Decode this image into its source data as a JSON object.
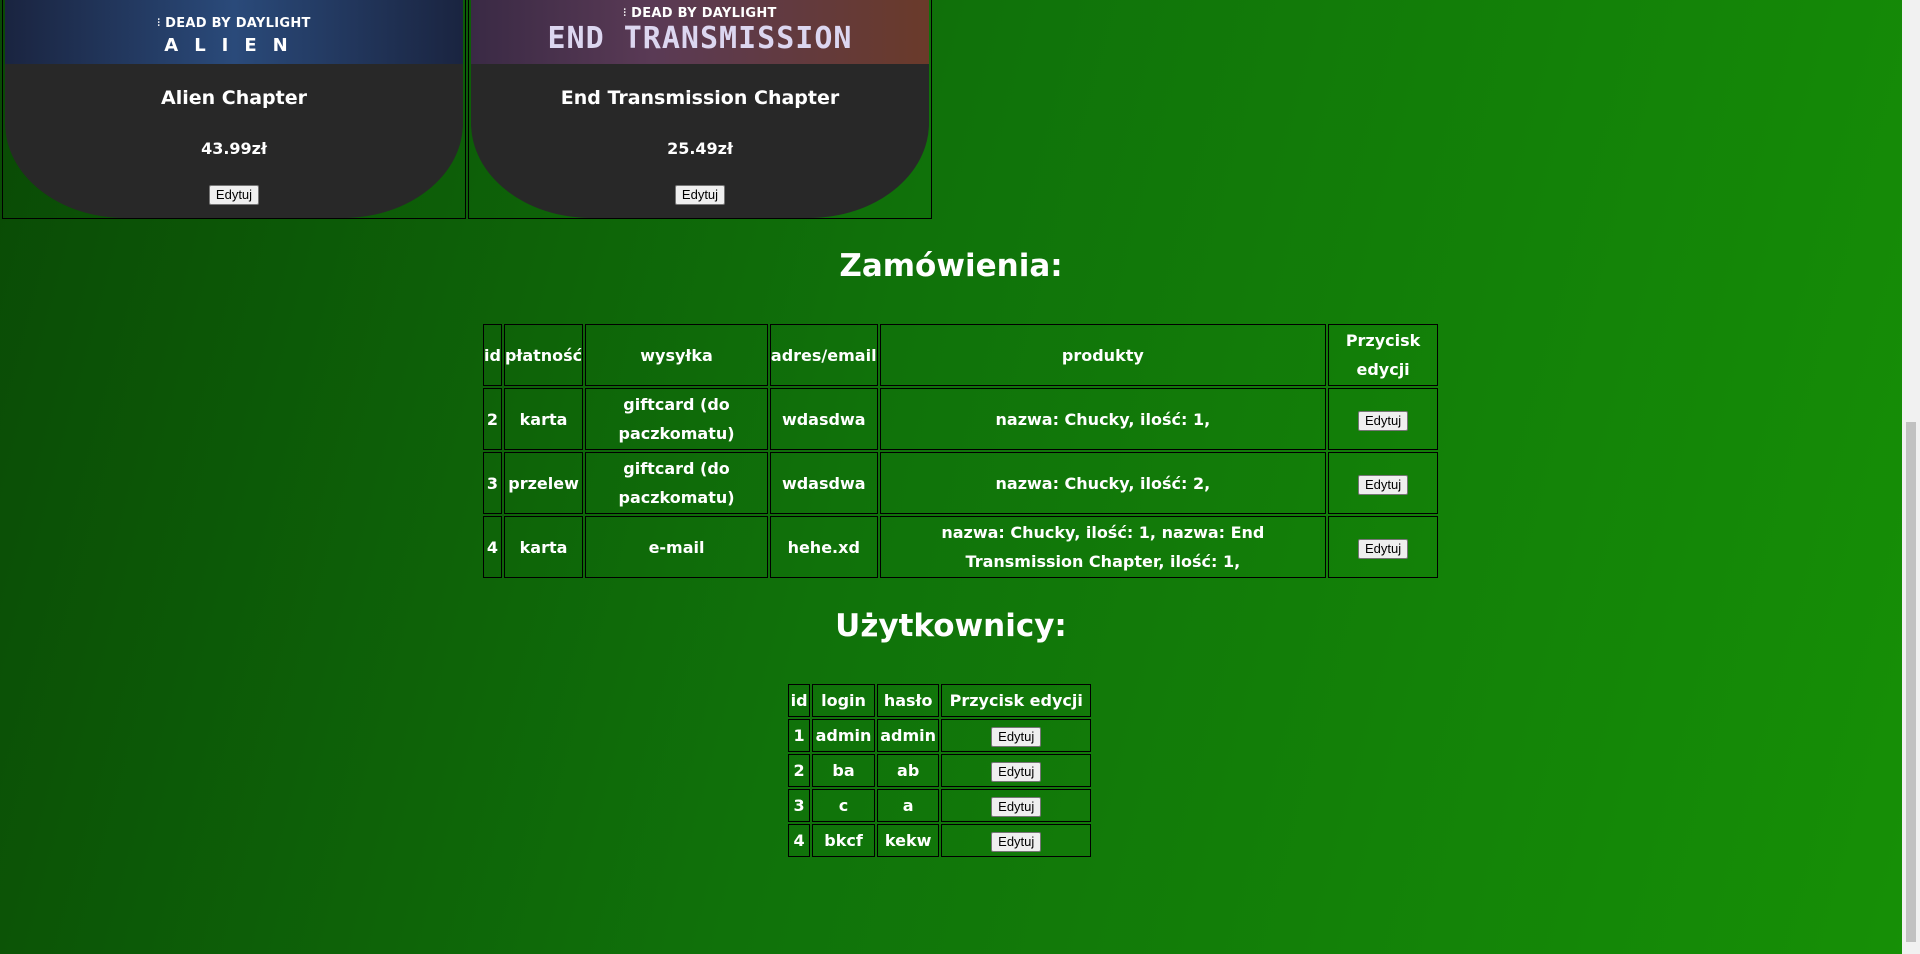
{
  "products": [
    {
      "banner_brand": "DEAD BY DAYLIGHT",
      "banner_game": "ALIEN",
      "title": "Alien Chapter",
      "price": "43.99zł",
      "button": "Edytuj"
    },
    {
      "banner_brand": "DEAD BY DAYLIGHT",
      "banner_game": "END TRANSMISSION",
      "title": "End Transmission Chapter",
      "price": "25.49zł",
      "button": "Edytuj"
    }
  ],
  "orders": {
    "heading": "Zamówienia:",
    "headers": [
      "id",
      "płatność",
      "wysyłka",
      "adres/email",
      "produkty",
      "Przycisk edycji"
    ],
    "rows": [
      {
        "id": "2",
        "payment": "karta",
        "shipping": "giftcard (do paczkomatu)",
        "address": "wdasdwa",
        "products": "nazwa: Chucky, ilość: 1,",
        "button": "Edytuj"
      },
      {
        "id": "3",
        "payment": "przelew",
        "shipping": "giftcard (do paczkomatu)",
        "address": "wdasdwa",
        "products": "nazwa: Chucky, ilość: 2,",
        "button": "Edytuj"
      },
      {
        "id": "4",
        "payment": "karta",
        "shipping": "e-mail",
        "address": "hehe.xd",
        "products": "nazwa: Chucky, ilość: 1, nazwa: End Transmission Chapter, ilość: 1,",
        "button": "Edytuj"
      }
    ]
  },
  "users": {
    "heading": "Użytkownicy:",
    "headers": [
      "id",
      "login",
      "hasło",
      "Przycisk edycji"
    ],
    "rows": [
      {
        "id": "1",
        "login": "admin",
        "password": "admin",
        "button": "Edytuj"
      },
      {
        "id": "2",
        "login": "ba",
        "password": "ab",
        "button": "Edytuj"
      },
      {
        "id": "3",
        "login": "c",
        "password": "a",
        "button": "Edytuj"
      },
      {
        "id": "4",
        "login": "bkcf",
        "password": "kekw",
        "button": "Edytuj"
      }
    ]
  },
  "colors": {
    "background_start": "#0a4a05",
    "background_end": "#169006",
    "card_bg": "#282828",
    "text": "#ffffff"
  }
}
